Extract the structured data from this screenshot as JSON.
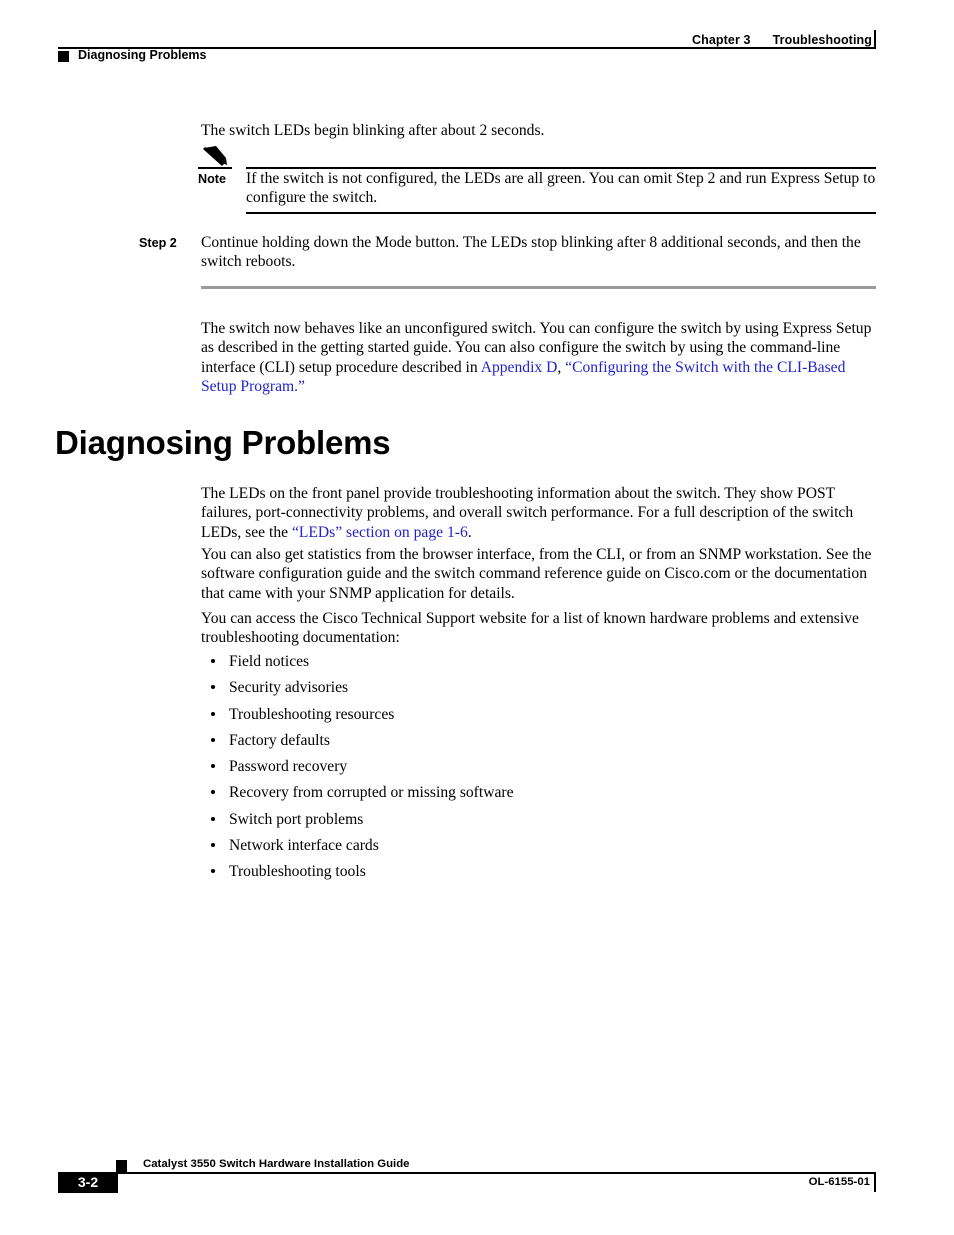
{
  "header": {
    "chapter_number": "Chapter 3",
    "chapter_title": "Troubleshooting",
    "section_title": "Diagnosing Problems"
  },
  "content": {
    "intro_line": "The switch LEDs begin blinking after about 2 seconds.",
    "note": {
      "label": "Note",
      "text": "If the switch is not configured, the LEDs are all green. You can omit Step 2 and run Express Setup to configure the switch."
    },
    "step": {
      "label": "Step 2",
      "text": "Continue holding down the Mode button. The LEDs stop blinking after 8 additional seconds, and then the switch reboots."
    },
    "para_unconfigured": {
      "before_link": "The switch now behaves like an unconfigured switch. You can configure the switch by using Express Setup as described in the getting started guide. You can also configure the switch by using the command-line interface (CLI) setup procedure described in ",
      "link_1": "Appendix D",
      "between": ", ",
      "link_2": "“Configuring the Switch with the CLI-Based Setup Program.”"
    },
    "heading": "Diagnosing Problems",
    "para_leds": {
      "before_link": "The LEDs on the front panel provide troubleshooting information about the switch. They show POST failures, port-connectivity problems, and overall switch performance. For a full description of the switch LEDs, see the ",
      "link": "“LEDs” section on page 1-6",
      "after_link": "."
    },
    "para_statistics": "You can also get statistics from the browser interface, from the CLI, or from an SNMP workstation. See the software configuration guide and the switch command reference guide on Cisco.com or the documentation that came with your SNMP application for details.",
    "para_support": "You can access the Cisco Technical Support website for a list of known hardware problems and extensive troubleshooting documentation:",
    "bullets": [
      "Field notices",
      "Security advisories",
      "Troubleshooting resources",
      "Factory defaults",
      "Password recovery",
      "Recovery from corrupted or missing software",
      "Switch port problems",
      "Network interface cards",
      "Troubleshooting tools"
    ]
  },
  "footer": {
    "guide_title": "Catalyst 3550 Switch Hardware Installation Guide",
    "page_number": "3-2",
    "document_id": "OL-6155-01"
  },
  "colors": {
    "link": "#2222cc",
    "rule": "#000000",
    "grey_rule": "#9a9a9a",
    "text": "#000000"
  }
}
